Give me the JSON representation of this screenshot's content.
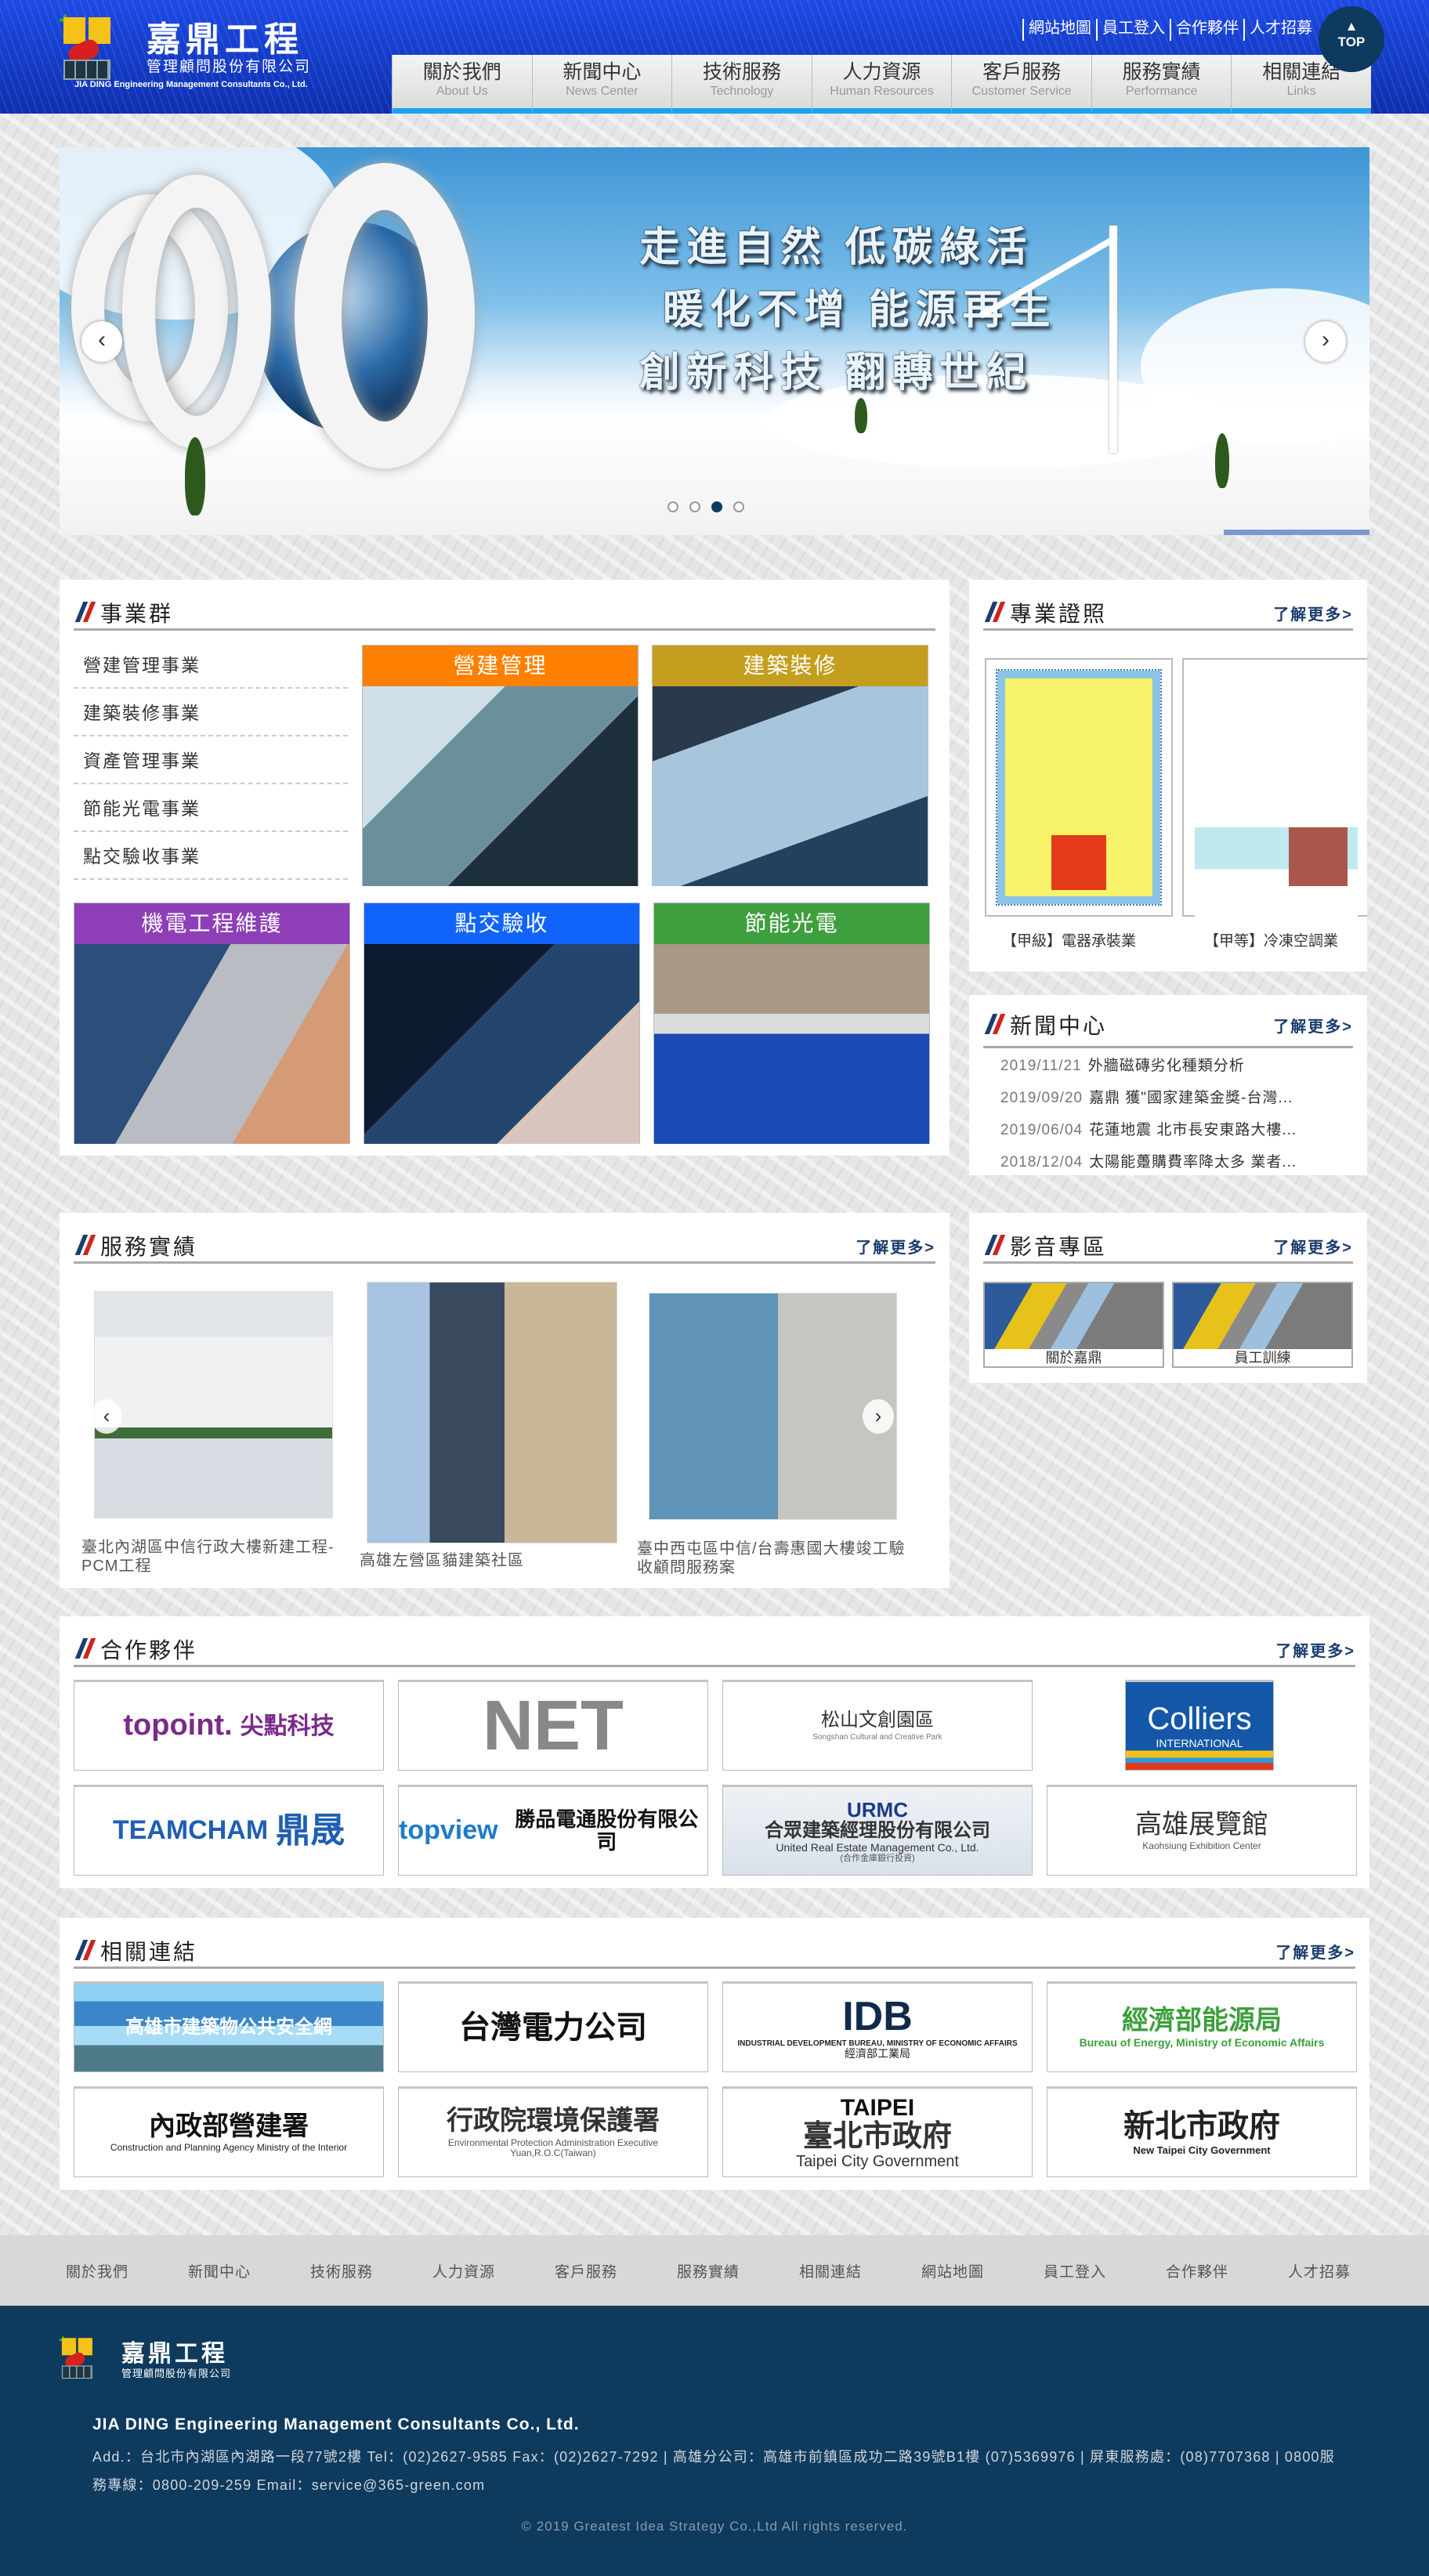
{
  "header": {
    "logo_title": "嘉鼎工程",
    "logo_subtitle": "管理顧問股份有限公司",
    "logo_english": "JIA DING Engineering Management Consultants Co., Ltd.",
    "top_links": [
      "網站地圖",
      "員工登入",
      "合作夥伴",
      "人才招募"
    ],
    "top_button": "TOP",
    "nav": [
      {
        "zh": "關於我們",
        "en": "About Us"
      },
      {
        "zh": "新聞中心",
        "en": "News Center"
      },
      {
        "zh": "技術服務",
        "en": "Technology"
      },
      {
        "zh": "人力資源",
        "en": "Human Resources"
      },
      {
        "zh": "客戶服務",
        "en": "Customer Service"
      },
      {
        "zh": "服務實績",
        "en": "Performance"
      },
      {
        "zh": "相關連結",
        "en": "Links"
      }
    ]
  },
  "banner": {
    "slogans": [
      "走進自然 低碳綠活",
      "暖化不增 能源再生",
      "創新科技 翻轉世紀"
    ],
    "prev_icon": "chevron-left-icon",
    "next_icon": "chevron-right-icon",
    "slide_count": 4,
    "active_slide": 3
  },
  "business": {
    "title": "事業群",
    "list": [
      "營建管理事業",
      "建築裝修事業",
      "資產管理事業",
      "節能光電事業",
      "點交驗收事業"
    ],
    "tiles": [
      {
        "label": "營建管理",
        "color": "#ff8000"
      },
      {
        "label": "建築裝修",
        "color": "#c49e1e"
      },
      {
        "label": "機電工程維護",
        "color": "#8e3fb8"
      },
      {
        "label": "點交驗收",
        "color": "#1164fb"
      },
      {
        "label": "節能光電",
        "color": "#3e9f3e"
      }
    ]
  },
  "certificates": {
    "title": "專業證照",
    "more": "了解更多>",
    "items": [
      "【甲級】電器承裝業",
      "【甲等】冷凍空調業"
    ]
  },
  "news": {
    "title": "新聞中心",
    "more": "了解更多>",
    "items": [
      {
        "date": "2019/11/21",
        "title": "外牆磁磚劣化種類分析"
      },
      {
        "date": "2019/09/20",
        "title": "嘉鼎 獲\"國家建築金獎-台灣..."
      },
      {
        "date": "2019/06/04",
        "title": "花蓮地震 北市長安東路大樓..."
      },
      {
        "date": "2018/12/04",
        "title": "太陽能躉購費率降太多 業者..."
      }
    ]
  },
  "performance": {
    "title": "服務實績",
    "more": "了解更多>",
    "items": [
      "臺北內湖區中信行政大樓新建工程-PCM工程",
      "高雄左營區貓建築社區",
      "臺中西屯區中信/台壽惠國大樓竣工驗收顧問服務案"
    ]
  },
  "video": {
    "title": "影音專區",
    "more": "了解更多>",
    "items": [
      "關於嘉鼎",
      "員工訓練"
    ]
  },
  "partners": {
    "title": "合作夥伴",
    "more": "了解更多>",
    "logos": [
      [
        "topoint.",
        "尖點科技"
      ],
      [
        "NET"
      ],
      [
        "松山文創園區",
        "Songshan Cultural and Creative Park"
      ],
      [
        "Colliers",
        "INTERNATIONAL"
      ],
      [
        "TEAMCHAM",
        "鼎晟"
      ],
      [
        "topview",
        "勝品電通股份有限公司"
      ],
      [
        "URMC",
        "合眾建築經理股份有限公司",
        "United Real Estate Management Co., Ltd.",
        "(合作金庫銀行投資)"
      ],
      [
        "高雄展覽館",
        "Kaohsiung Exhibition Center"
      ]
    ]
  },
  "links": {
    "title": "相關連結",
    "more": "了解更多>",
    "logos": [
      [
        "高雄市建築物公共安全網"
      ],
      [
        "台灣電力公司"
      ],
      [
        "IDB",
        "INDUSTRIAL DEVELOPMENT BUREAU, MINISTRY OF ECONOMIC AFFAIRS",
        "經濟部工業局"
      ],
      [
        "經濟部能源局",
        "Bureau of Energy, Ministry of Economic Affairs"
      ],
      [
        "內政部營建署",
        "Construction and Planning Agency Ministry of the Interior"
      ],
      [
        "行政院環境保護署",
        "Environmental Protection Administration Executive Yuan,R.O.C(Taiwan)"
      ],
      [
        "TAIPEI",
        "臺北市政府",
        "Taipei City Government"
      ],
      [
        "新北市政府",
        "New Taipei City Government"
      ]
    ]
  },
  "footer_nav": [
    "關於我們",
    "新聞中心",
    "技術服務",
    "人力資源",
    "客戶服務",
    "服務實績",
    "相關連結",
    "網站地圖",
    "員工登入",
    "合作夥伴",
    "人才招募"
  ],
  "footer": {
    "company": "JIA DING Engineering Management Consultants Co., Ltd.",
    "address": "Add.：台北市內湖區內湖路一段77號2樓 Tel：(02)2627-9585 Fax：(02)2627-7292 | 高雄分公司：高雄市前鎮區成功二路39號B1樓 (07)5369976 | 屏東服務處：(08)7707368 | 0800服務專線：0800-209-259 Email：service@365-green.com",
    "copyright": "© 2019 Greatest Idea Strategy Co.,Ltd All rights reserved."
  }
}
